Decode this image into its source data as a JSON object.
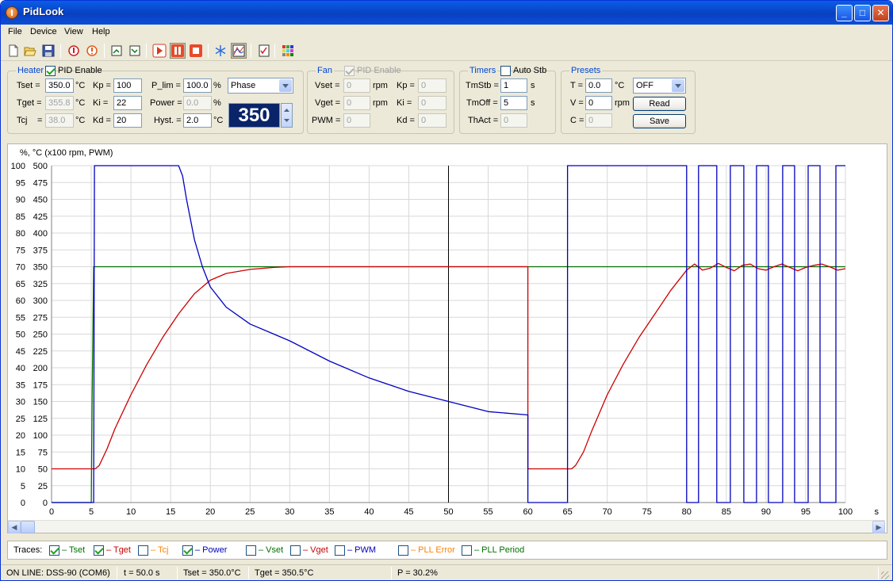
{
  "window": {
    "title": "PidLook",
    "minimize": "_",
    "maximize": "□",
    "close": "✕"
  },
  "menu": [
    "File",
    "Device",
    "View",
    "Help"
  ],
  "toolbar": {
    "icons": [
      "new-icon",
      "open-icon",
      "save-icon",
      "power-on-icon",
      "power-off-icon",
      "export-icon",
      "import-icon",
      "play-icon",
      "pause-icon",
      "stop-icon",
      "snowflake-icon",
      "chart-icon",
      "checklist-icon",
      "grid-icon"
    ]
  },
  "heater": {
    "title": "Heater",
    "pid_enable": "PID Enable",
    "pid_enabled": true,
    "tset_label": "Tset =",
    "tset": "350.0",
    "tset_unit": "°C",
    "tget_label": "Tget =",
    "tget": "355.8",
    "tget_unit": "°C",
    "tcj_label": "Tcj",
    "tcj_eq": "=",
    "tcj": "38.0",
    "tcj_unit": "°C",
    "kp_label": "Kp =",
    "kp": "100",
    "ki_label": "Ki =",
    "ki": "22",
    "kd_label": "Kd =",
    "kd": "20",
    "plim_label": "P_lim =",
    "plim": "100.0",
    "plim_unit": "%",
    "power_label": "Power =",
    "power": "0.0",
    "power_unit": "%",
    "hyst_label": "Hyst. =",
    "hyst": "2.0",
    "hyst_unit": "°C",
    "mode": "Phase",
    "display": "350"
  },
  "fan": {
    "title": "Fan",
    "pid_enable": "PID Enable",
    "vset_label": "Vset =",
    "vset": "0",
    "vset_unit": "rpm",
    "vget_label": "Vget =",
    "vget": "0",
    "vget_unit": "rpm",
    "pwm_label": "PWM =",
    "pwm": "0",
    "kp_label": "Kp =",
    "kp": "0",
    "ki_label": "Ki =",
    "ki": "0",
    "kd_label": "Kd =",
    "kd": "0"
  },
  "timers": {
    "title": "Timers",
    "auto_stb": "Auto Stb",
    "tmstb_label": "TmStb =",
    "tmstb": "1",
    "tmstb_unit": "s",
    "tmoff_label": "TmOff =",
    "tmoff": "5",
    "tmoff_unit": "s",
    "thact_label": "ThAct =",
    "thact": "0"
  },
  "presets": {
    "title": "Presets",
    "t_label": "T =",
    "t": "0.0",
    "t_unit": "°C",
    "v_label": "V =",
    "v": "0",
    "v_unit": "rpm",
    "c_label": "C =",
    "c": "0",
    "mode": "OFF",
    "read": "Read",
    "save": "Save"
  },
  "chart_data": {
    "type": "line",
    "ylabel": "%,   °C  (x100 rpm, PWM)",
    "xlabel": "s",
    "xlim": [
      0,
      100
    ],
    "ylim_percent": [
      0,
      100
    ],
    "ylim_temp": [
      0,
      500
    ],
    "x_ticks": [
      0,
      5,
      10,
      15,
      20,
      25,
      30,
      35,
      40,
      45,
      50,
      55,
      60,
      65,
      70,
      75,
      80,
      85,
      90,
      95,
      100
    ],
    "y_ticks_percent": [
      0,
      5,
      10,
      15,
      20,
      25,
      30,
      35,
      40,
      45,
      50,
      55,
      60,
      65,
      70,
      75,
      80,
      85,
      90,
      95,
      100
    ],
    "y_ticks_temp": [
      0,
      25,
      50,
      75,
      100,
      125,
      150,
      175,
      200,
      225,
      250,
      275,
      300,
      325,
      350,
      375,
      400,
      425,
      450,
      475,
      500
    ],
    "grid": true,
    "cursor_x": 50,
    "series": [
      {
        "name": "Tset",
        "color": "#007000",
        "x": [
          0,
          5,
          5.1,
          5.2,
          5.3,
          5.4,
          65,
          65,
          100
        ],
        "y": [
          0,
          0,
          150,
          250,
          350,
          350,
          350,
          350,
          350
        ]
      },
      {
        "name": "Tget",
        "color": "#cc0000",
        "x": [
          0,
          5.5,
          6,
          7,
          8,
          10,
          12,
          14,
          16,
          18,
          20,
          22,
          25,
          28,
          30,
          60,
          60,
          65,
          65.5,
          66,
          67,
          68,
          70,
          72,
          74,
          76,
          78,
          80,
          81,
          82,
          83,
          84,
          85,
          86,
          87,
          88,
          89,
          90,
          91,
          92,
          93,
          94,
          95,
          96,
          97,
          98,
          99,
          100
        ],
        "y": [
          50,
          50,
          55,
          80,
          110,
          160,
          205,
          245,
          280,
          310,
          330,
          340,
          346,
          349,
          350,
          350,
          50,
          50,
          50,
          55,
          75,
          105,
          160,
          205,
          245,
          280,
          315,
          345,
          354,
          345,
          348,
          355,
          349,
          344,
          352,
          354,
          347,
          345,
          350,
          354,
          349,
          344,
          349,
          352,
          354,
          350,
          345,
          347
        ]
      },
      {
        "name": "Power",
        "color": "#0000c0",
        "x": [
          0,
          5.3,
          5.4,
          16,
          16.5,
          17,
          18,
          19,
          20,
          22,
          25,
          28,
          30,
          35,
          40,
          45,
          50,
          55,
          60,
          60,
          65,
          65,
          80,
          80,
          81.5,
          81.5,
          83.8,
          83.8,
          85.5,
          85.5,
          87.2,
          87.2,
          88.8,
          88.8,
          90.3,
          90.3,
          92.1,
          92.1,
          93.6,
          93.6,
          95.3,
          95.3,
          96.8,
          96.8,
          98.8,
          98.8,
          99.6,
          100
        ],
        "y": [
          0,
          0,
          100,
          100,
          97,
          90,
          78,
          70,
          64,
          58,
          53,
          50,
          48,
          42,
          37,
          33,
          30,
          27,
          26,
          0,
          0,
          100,
          100,
          0,
          0,
          100,
          100,
          0,
          0,
          100,
          100,
          0,
          0,
          100,
          100,
          0,
          0,
          100,
          100,
          0,
          0,
          100,
          100,
          0,
          0,
          100,
          100,
          100
        ]
      }
    ]
  },
  "traces": {
    "label": "Traces:",
    "items": [
      {
        "name": "– Tset",
        "checked": true,
        "color": "#007000"
      },
      {
        "name": "– Tget",
        "checked": true,
        "color": "#cc0000"
      },
      {
        "name": "– Tcj",
        "checked": false,
        "color": "#ff8000"
      },
      {
        "name": "– Power",
        "checked": true,
        "color": "#0000c0"
      },
      {
        "name": "– Vset",
        "checked": false,
        "color": "#007000"
      },
      {
        "name": "– Vget",
        "checked": false,
        "color": "#cc0000"
      },
      {
        "name": "– PWM",
        "checked": false,
        "color": "#0000c0"
      },
      {
        "name": "– PLL Error",
        "checked": false,
        "color": "#ff8000"
      },
      {
        "name": "– PLL Period",
        "checked": false,
        "color": "#007000"
      }
    ]
  },
  "status": {
    "connection": "ON LINE: DSS-90 (COM6)",
    "time": "t = 50.0 s",
    "tset": "Tset = 350.0°C",
    "tget": "Tget = 350.5°C",
    "power": "P = 30.2%"
  }
}
